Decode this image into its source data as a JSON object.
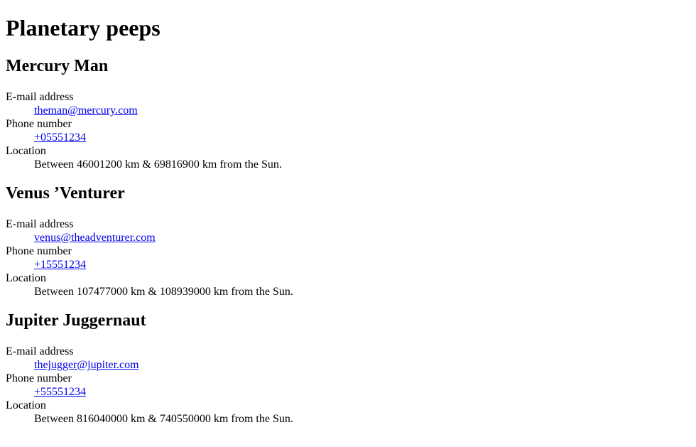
{
  "page": {
    "title": "Planetary peeps"
  },
  "labels": {
    "email": "E-mail address",
    "phone": "Phone number",
    "location": "Location"
  },
  "people": [
    {
      "name": "Mercury Man",
      "email": "theman@mercury.com",
      "email_href": "mailto:theman@mercury.com",
      "phone": "+05551234",
      "phone_href": "tel:+05551234",
      "location": "Between 46001200 km & 69816900 km from the Sun."
    },
    {
      "name": "Venus ’Venturer",
      "email": "venus@theadventurer.com",
      "email_href": "mailto:venus@theadventurer.com",
      "phone": "+15551234",
      "phone_href": "tel:+15551234",
      "location": "Between 107477000 km & 108939000 km from the Sun."
    },
    {
      "name": "Jupiter Juggernaut",
      "email": "thejugger@jupiter.com",
      "email_href": "mailto:thejugger@jupiter.com",
      "phone": "+55551234",
      "phone_href": "tel:+55551234",
      "location": "Between 816040000 km & 740550000 km from the Sun."
    }
  ],
  "colors": {
    "text": "#000000",
    "link": "#0000ee",
    "background": "#ffffff"
  }
}
